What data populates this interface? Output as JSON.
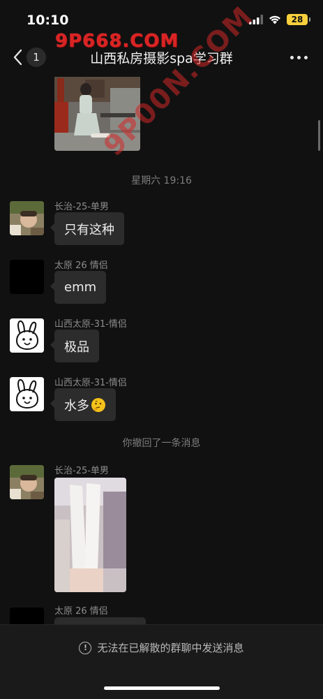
{
  "status_bar": {
    "time": "10:10",
    "battery": "28"
  },
  "watermark": {
    "top": "9P668.COM",
    "diagonal": "9P00N.COM"
  },
  "nav": {
    "unread_count": "1",
    "title": "山西私房摄影spa学习群"
  },
  "chat": {
    "timestamp": "星期六 19:16",
    "recall_notice": "你撤回了一条消息",
    "messages": [
      {
        "sender": "长治-25-单男",
        "text": "只有这种"
      },
      {
        "sender": "太原 26 情侣",
        "text": "emm"
      },
      {
        "sender": "山西太原-31-情侣",
        "text": "极品"
      },
      {
        "sender": "山西太原-31-情侣",
        "text": "水多"
      },
      {
        "sender": "长治-25-单男"
      },
      {
        "sender": "太原 26 情侣"
      }
    ]
  },
  "bottom": {
    "notice": "无法在已解散的群聊中发送消息"
  },
  "colors": {
    "background": "#111111",
    "bubble": "#2c2c2c",
    "battery": "#f7d03c",
    "watermark": "#d92424"
  }
}
